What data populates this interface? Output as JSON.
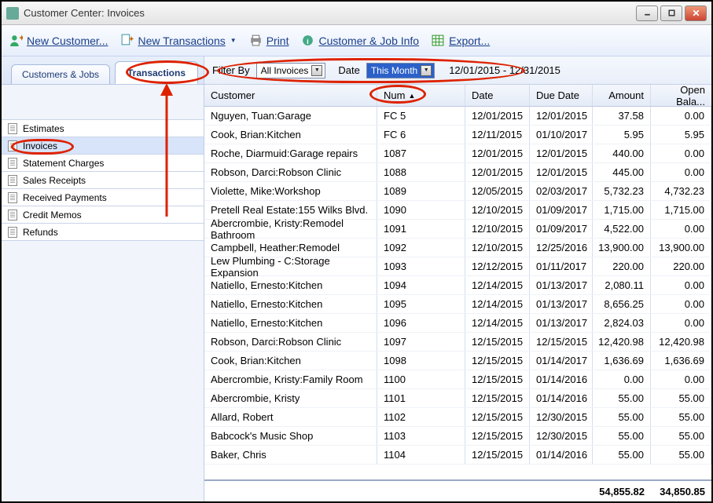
{
  "title": "Customer Center: Invoices",
  "toolbar": {
    "new_customer": "New Customer...",
    "new_transactions": "New Transactions",
    "print": "Print",
    "cust_job_info": "Customer & Job Info",
    "export": "Export..."
  },
  "tabs": {
    "customers_jobs": "Customers & Jobs",
    "transactions": "Transactions"
  },
  "types": [
    "Estimates",
    "Invoices",
    "Statement Charges",
    "Sales Receipts",
    "Received Payments",
    "Credit Memos",
    "Refunds"
  ],
  "selected_type_index": 1,
  "filter": {
    "filter_by_label": "Filter By",
    "filter_by_value": "All Invoices",
    "date_label": "Date",
    "date_value": "This Month",
    "date_range": "12/01/2015 - 12/31/2015"
  },
  "columns": {
    "customer": "Customer",
    "num": "Num",
    "date": "Date",
    "due": "Due Date",
    "amount": "Amount",
    "open": "Open Bala..."
  },
  "sort_column": "num",
  "rows": [
    {
      "customer": "Nguyen, Tuan:Garage",
      "num": "FC 5",
      "date": "12/01/2015",
      "due": "12/01/2015",
      "amount": "37.58",
      "open": "0.00"
    },
    {
      "customer": "Cook, Brian:Kitchen",
      "num": "FC 6",
      "date": "12/11/2015",
      "due": "01/10/2017",
      "amount": "5.95",
      "open": "5.95"
    },
    {
      "customer": "Roche, Diarmuid:Garage repairs",
      "num": "1087",
      "date": "12/01/2015",
      "due": "12/01/2015",
      "amount": "440.00",
      "open": "0.00"
    },
    {
      "customer": "Robson, Darci:Robson Clinic",
      "num": "1088",
      "date": "12/01/2015",
      "due": "12/01/2015",
      "amount": "445.00",
      "open": "0.00"
    },
    {
      "customer": "Violette, Mike:Workshop",
      "num": "1089",
      "date": "12/05/2015",
      "due": "02/03/2017",
      "amount": "5,732.23",
      "open": "4,732.23"
    },
    {
      "customer": "Pretell Real Estate:155 Wilks Blvd.",
      "num": "1090",
      "date": "12/10/2015",
      "due": "01/09/2017",
      "amount": "1,715.00",
      "open": "1,715.00"
    },
    {
      "customer": "Abercrombie, Kristy:Remodel Bathroom",
      "num": "1091",
      "date": "12/10/2015",
      "due": "01/09/2017",
      "amount": "4,522.00",
      "open": "0.00"
    },
    {
      "customer": "Campbell, Heather:Remodel",
      "num": "1092",
      "date": "12/10/2015",
      "due": "12/25/2016",
      "amount": "13,900.00",
      "open": "13,900.00"
    },
    {
      "customer": "Lew Plumbing - C:Storage Expansion",
      "num": "1093",
      "date": "12/12/2015",
      "due": "01/11/2017",
      "amount": "220.00",
      "open": "220.00"
    },
    {
      "customer": "Natiello, Ernesto:Kitchen",
      "num": "1094",
      "date": "12/14/2015",
      "due": "01/13/2017",
      "amount": "2,080.11",
      "open": "0.00"
    },
    {
      "customer": "Natiello, Ernesto:Kitchen",
      "num": "1095",
      "date": "12/14/2015",
      "due": "01/13/2017",
      "amount": "8,656.25",
      "open": "0.00"
    },
    {
      "customer": "Natiello, Ernesto:Kitchen",
      "num": "1096",
      "date": "12/14/2015",
      "due": "01/13/2017",
      "amount": "2,824.03",
      "open": "0.00"
    },
    {
      "customer": "Robson, Darci:Robson Clinic",
      "num": "1097",
      "date": "12/15/2015",
      "due": "12/15/2015",
      "amount": "12,420.98",
      "open": "12,420.98"
    },
    {
      "customer": "Cook, Brian:Kitchen",
      "num": "1098",
      "date": "12/15/2015",
      "due": "01/14/2017",
      "amount": "1,636.69",
      "open": "1,636.69"
    },
    {
      "customer": "Abercrombie, Kristy:Family Room",
      "num": "1100",
      "date": "12/15/2015",
      "due": "01/14/2016",
      "amount": "0.00",
      "open": "0.00"
    },
    {
      "customer": "Abercrombie, Kristy",
      "num": "1101",
      "date": "12/15/2015",
      "due": "01/14/2016",
      "amount": "55.00",
      "open": "55.00"
    },
    {
      "customer": "Allard, Robert",
      "num": "1102",
      "date": "12/15/2015",
      "due": "12/30/2015",
      "amount": "55.00",
      "open": "55.00"
    },
    {
      "customer": "Babcock's Music Shop",
      "num": "1103",
      "date": "12/15/2015",
      "due": "12/30/2015",
      "amount": "55.00",
      "open": "55.00"
    },
    {
      "customer": "Baker, Chris",
      "num": "1104",
      "date": "12/15/2015",
      "due": "01/14/2016",
      "amount": "55.00",
      "open": "55.00"
    }
  ],
  "totals": {
    "amount": "54,855.82",
    "open": "34,850.85"
  }
}
